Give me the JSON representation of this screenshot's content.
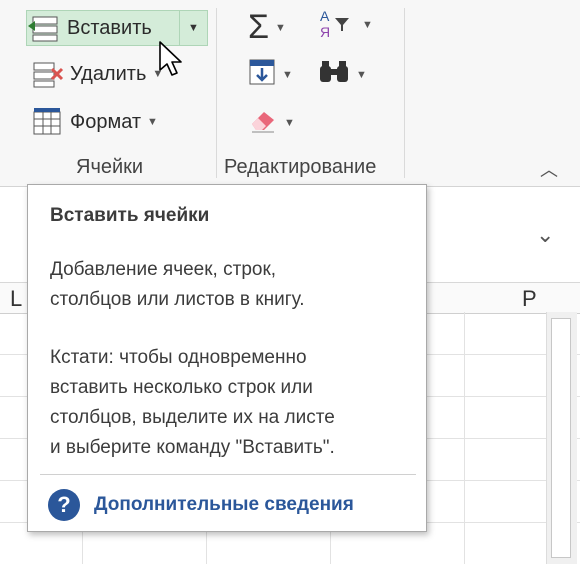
{
  "ribbon": {
    "cells_group": {
      "label": "Ячейки",
      "insert_label": "Вставить",
      "delete_label": "Удалить",
      "format_label": "Формат"
    },
    "editing_group": {
      "label": "Редактирование",
      "sum_symbol": "Σ",
      "sort_letters_top": "А",
      "sort_letters_bottom": "Я"
    },
    "colors": {
      "insert_highlight": "#d4ecd9",
      "accent_blue": "#2b579a"
    }
  },
  "sheet": {
    "column_letters": [
      "L",
      "P"
    ]
  },
  "tooltip": {
    "title": "Вставить ячейки",
    "description": "Добавление ячеек, строк,\nстолбцов или листов в книгу.",
    "tip": "Кстати: чтобы одновременно\nвставить несколько строк или\nстолбцов, выделите их на листе\nи выберите команду \"Вставить\".",
    "help_icon_char": "?",
    "help_link": "Дополнительные сведения"
  }
}
